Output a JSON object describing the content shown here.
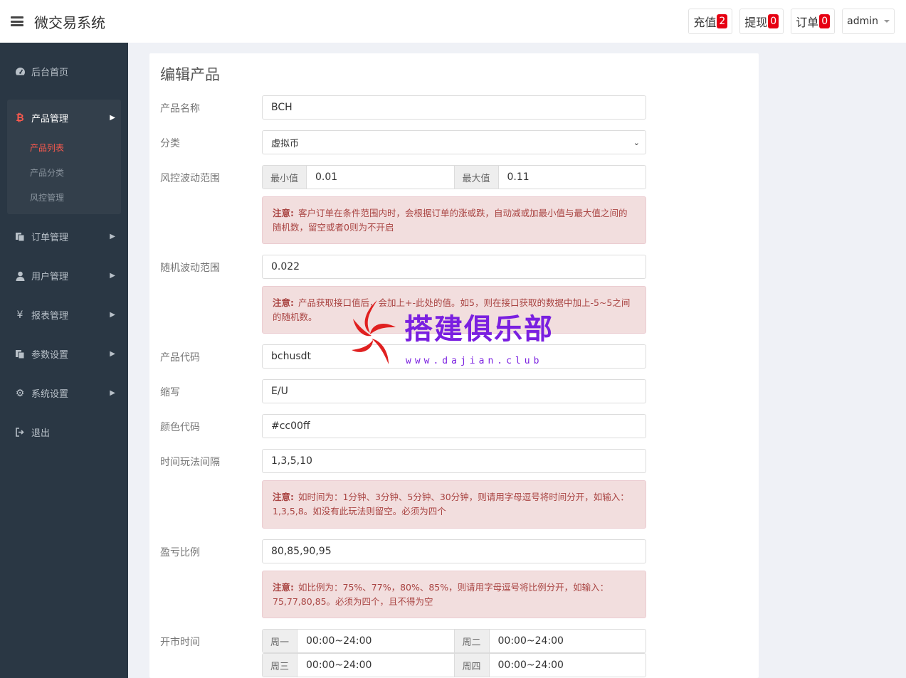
{
  "header": {
    "title": "微交易系统",
    "recharge_label": "充值",
    "recharge_count": "2",
    "withdraw_label": "提现",
    "withdraw_count": "0",
    "orders_label": "订单",
    "orders_count": "0",
    "user_label": "admin"
  },
  "sidebar": {
    "home": "后台首页",
    "product_mgmt": "产品管理",
    "product_list": "产品列表",
    "product_category": "产品分类",
    "risk_mgmt": "风控管理",
    "order_mgmt": "订单管理",
    "user_mgmt": "用户管理",
    "report_mgmt": "报表管理",
    "param_settings": "参数设置",
    "system_settings": "系统设置",
    "logout": "退出"
  },
  "form": {
    "title": "编辑产品",
    "name_label": "产品名称",
    "name_value": "BCH",
    "category_label": "分类",
    "category_value": "虚拟币",
    "risk_label": "风控波动范围",
    "risk_min_label": "最小值",
    "risk_min_value": "0.01",
    "risk_max_label": "最大值",
    "risk_max_value": "0.11",
    "risk_notice_prefix": "注意:",
    "risk_notice": "客户订单在条件范围内时，会根据订单的涨或跌，自动减或加最小值与最大值之间的随机数，留空或者0则为不开启",
    "random_label": "随机波动范围",
    "random_value": "0.022",
    "random_notice_prefix": "注意:",
    "random_notice": "产品获取接口值后，会加上+-此处的值。如5，则在接口获取的数据中加上-5~5之间的随机数。",
    "code_label": "产品代码",
    "code_value": "bchusdt",
    "abbr_label": "缩写",
    "abbr_value": "E/U",
    "color_label": "颜色代码",
    "color_value": "#cc00ff",
    "interval_label": "时间玩法间隔",
    "interval_value": "1,3,5,10",
    "interval_notice_prefix": "注意:",
    "interval_notice": "如时间为：1分钟、3分钟、5分钟、30分钟，则请用字母逗号将时间分开，如输入：1,3,5,8。如没有此玩法则留空。必须为四个",
    "ratio_label": "盈亏比例",
    "ratio_value": "80,85,90,95",
    "ratio_notice_prefix": "注意:",
    "ratio_notice": "如比例为：75%、77%，80%、85%，则请用字母逗号将比例分开，如输入：75,77,80,85。必须为四个，且不得为空",
    "market_label": "开市时间",
    "mon_label": "周一",
    "mon_value": "00:00~24:00",
    "tue_label": "周二",
    "tue_value": "00:00~24:00",
    "wed_label": "周三",
    "wed_value": "00:00~24:00",
    "thu_label": "周四",
    "thu_value": "00:00~24:00"
  },
  "watermark": {
    "text": "搭建俱乐部",
    "url": "www.dajian.club"
  },
  "colors": {
    "sidebar_bg": "#2a3744",
    "accent": "#ff5a4e",
    "badge": "#e60012",
    "notice_bg": "#f2dede",
    "notice_text": "#a94442",
    "watermark": "#7a1fe0"
  }
}
